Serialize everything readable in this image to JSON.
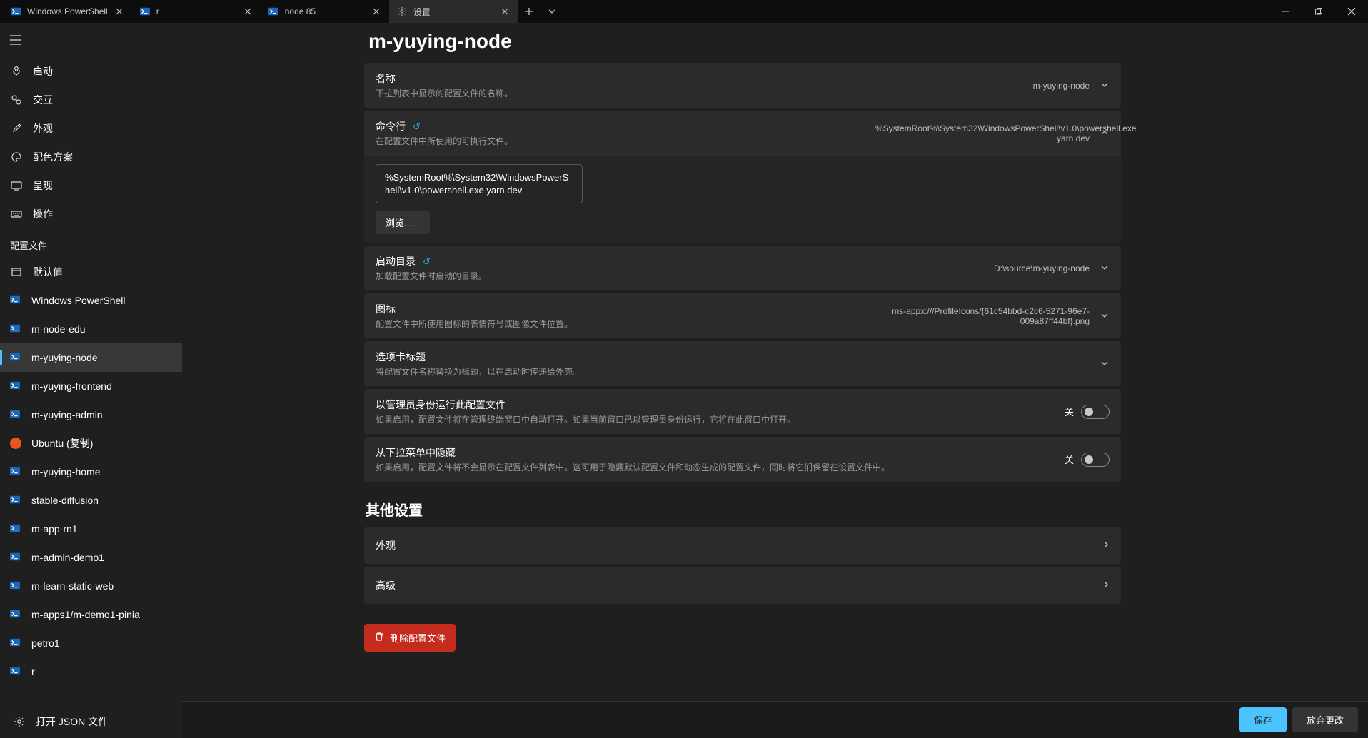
{
  "tabs": [
    {
      "label": "Windows PowerShell",
      "icon": "powershell"
    },
    {
      "label": "r",
      "icon": "powershell"
    },
    {
      "label": "node 85",
      "icon": "powershell"
    },
    {
      "label": "设置",
      "icon": "settings",
      "active": true
    }
  ],
  "sidebar": {
    "nav": [
      {
        "label": "启动",
        "icon": "rocket"
      },
      {
        "label": "交互",
        "icon": "interact"
      },
      {
        "label": "外观",
        "icon": "brush"
      },
      {
        "label": "配色方案",
        "icon": "palette"
      },
      {
        "label": "呈现",
        "icon": "monitor"
      },
      {
        "label": "操作",
        "icon": "keyboard"
      }
    ],
    "profiles_header": "配置文件",
    "profiles": [
      {
        "label": "默认值",
        "icon": "defaults"
      },
      {
        "label": "Windows PowerShell",
        "icon": "powershell"
      },
      {
        "label": "m-node-edu",
        "icon": "powershell"
      },
      {
        "label": "m-yuying-node",
        "icon": "powershell",
        "active": true
      },
      {
        "label": "m-yuying-frontend",
        "icon": "powershell"
      },
      {
        "label": "m-yuying-admin",
        "icon": "powershell"
      },
      {
        "label": "Ubuntu (复制)",
        "icon": "ubuntu"
      },
      {
        "label": "m-yuying-home",
        "icon": "powershell"
      },
      {
        "label": "stable-diffusion",
        "icon": "powershell"
      },
      {
        "label": "m-app-rn1",
        "icon": "powershell"
      },
      {
        "label": "m-admin-demo1",
        "icon": "powershell"
      },
      {
        "label": "m-learn-static-web",
        "icon": "powershell"
      },
      {
        "label": "m-apps1/m-demo1-pinia",
        "icon": "powershell"
      },
      {
        "label": "petro1",
        "icon": "powershell"
      },
      {
        "label": "r",
        "icon": "powershell"
      }
    ],
    "open_json": "打开 JSON 文件"
  },
  "page": {
    "title": "m-yuying-node",
    "name": {
      "title": "名称",
      "desc": "下拉列表中显示的配置文件的名称。",
      "value": "m-yuying-node"
    },
    "commandline": {
      "title": "命令行",
      "desc": "在配置文件中所使用的可执行文件。",
      "summary": "%SystemRoot%\\System32\\WindowsPowerShell\\v1.0\\powershell.exe yarn dev",
      "field": "%SystemRoot%\\System32\\WindowsPowerShell\\v1.0\\powershell.exe yarn dev",
      "browse": "浏览......"
    },
    "startdir": {
      "title": "启动目录",
      "desc": "加载配置文件时启动的目录。",
      "value": "D:\\source\\m-yuying-node"
    },
    "icon": {
      "title": "图标",
      "desc": "配置文件中所使用图标的表情符号或图像文件位置。",
      "value": "ms-appx:///ProfileIcons/{61c54bbd-c2c6-5271-96e7-009a87ff44bf}.png"
    },
    "tabtitle": {
      "title": "选项卡标题",
      "desc": "将配置文件名称替换为标题，以在启动时传递给外壳。"
    },
    "admin": {
      "title": "以管理员身份运行此配置文件",
      "desc": "如果启用，配置文件将在管理终端窗口中自动打开。如果当前窗口已以管理员身份运行，它将在此窗口中打开。",
      "state": "关"
    },
    "hide": {
      "title": "从下拉菜单中隐藏",
      "desc": "如果启用，配置文件将不会显示在配置文件列表中。这可用于隐藏默认配置文件和动态生成的配置文件，同时将它们保留在设置文件中。",
      "state": "关"
    },
    "other_heading": "其他设置",
    "appearance_link": "外观",
    "advanced_link": "高级",
    "delete": "删除配置文件"
  },
  "footer": {
    "save": "保存",
    "discard": "放弃更改"
  }
}
